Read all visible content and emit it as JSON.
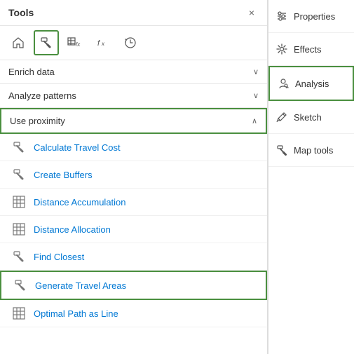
{
  "leftPanel": {
    "title": "Tools",
    "toolbar": {
      "icons": [
        {
          "name": "home",
          "unicode": "⌂",
          "active": false
        },
        {
          "name": "hammer",
          "active": true
        },
        {
          "name": "grid-fx",
          "active": false
        },
        {
          "name": "fx",
          "active": false
        },
        {
          "name": "history",
          "active": false
        }
      ]
    },
    "sections": [
      {
        "name": "enrich-data",
        "label": "Enrich data",
        "expanded": false,
        "chevron": "∨"
      },
      {
        "name": "analyze-patterns",
        "label": "Analyze patterns",
        "expanded": false,
        "chevron": "∨"
      },
      {
        "name": "use-proximity",
        "label": "Use proximity",
        "expanded": true,
        "chevron": "∧",
        "active": true
      }
    ],
    "tools": [
      {
        "name": "calculate-travel-cost",
        "label": "Calculate Travel Cost",
        "iconType": "hammer"
      },
      {
        "name": "create-buffers",
        "label": "Create Buffers",
        "iconType": "hammer"
      },
      {
        "name": "distance-accumulation",
        "label": "Distance Accumulation",
        "iconType": "grid"
      },
      {
        "name": "distance-allocation",
        "label": "Distance Allocation",
        "iconType": "grid"
      },
      {
        "name": "find-closest",
        "label": "Find Closest",
        "iconType": "hammer"
      },
      {
        "name": "generate-travel-areas",
        "label": "Generate Travel Areas",
        "iconType": "hammer",
        "highlighted": true
      },
      {
        "name": "optimal-path-as-line",
        "label": "Optimal Path as Line",
        "iconType": "grid"
      }
    ],
    "close": "×"
  },
  "rightPanel": {
    "items": [
      {
        "name": "properties",
        "label": "Properties",
        "iconType": "sliders"
      },
      {
        "name": "effects",
        "label": "Effects",
        "iconType": "sparkle"
      },
      {
        "name": "analysis",
        "label": "Analysis",
        "iconType": "person-analysis",
        "active": true
      },
      {
        "name": "sketch",
        "label": "Sketch",
        "iconType": "pencil"
      },
      {
        "name": "map-tools",
        "label": "Map tools",
        "iconType": "wrench"
      }
    ]
  }
}
